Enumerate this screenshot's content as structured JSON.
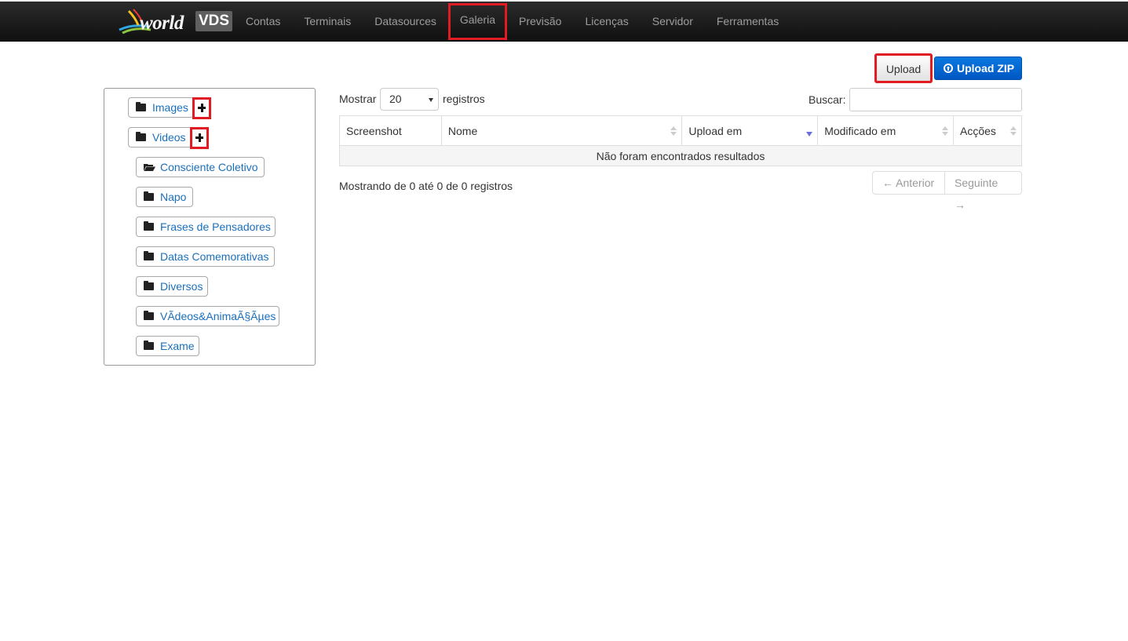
{
  "brand": {
    "world": "world",
    "vds": "VDS"
  },
  "nav": {
    "items": [
      {
        "label": "Contas"
      },
      {
        "label": "Terminais"
      },
      {
        "label": "Datasources"
      },
      {
        "label": "Galeria",
        "active": true
      },
      {
        "label": "Previsão"
      },
      {
        "label": "Licenças"
      },
      {
        "label": "Servidor"
      },
      {
        "label": "Ferramentas"
      }
    ]
  },
  "actions": {
    "upload": "Upload",
    "upload_zip": "Upload ZIP"
  },
  "tree": {
    "roots": [
      {
        "label": "Images"
      },
      {
        "label": "Videos"
      }
    ],
    "children": [
      {
        "label": "Consciente Coletivo",
        "open": true
      },
      {
        "label": "Napo"
      },
      {
        "label": "Frases de Pensadores"
      },
      {
        "label": "Datas Comemorativas"
      },
      {
        "label": "Diversos"
      },
      {
        "label": "VÃdeos&AnimaÃ§Ãµes"
      },
      {
        "label": "Exame"
      }
    ]
  },
  "table_controls": {
    "show_label": "Mostrar",
    "page_size": "20",
    "records_label": "registros",
    "search_label": "Buscar:",
    "search_value": ""
  },
  "table": {
    "columns": [
      "Screenshot",
      "Nome",
      "Upload em",
      "Modificado em",
      "Acções"
    ],
    "empty_message": "Não foram encontrados resultados"
  },
  "footer": {
    "info": "Mostrando de 0 até 0 de 0 registros",
    "prev": "← Anterior",
    "next": "Seguinte →"
  },
  "colors": {
    "highlight": "#e11b22",
    "primary": "#0a79e0",
    "link": "#1a6fbd"
  }
}
